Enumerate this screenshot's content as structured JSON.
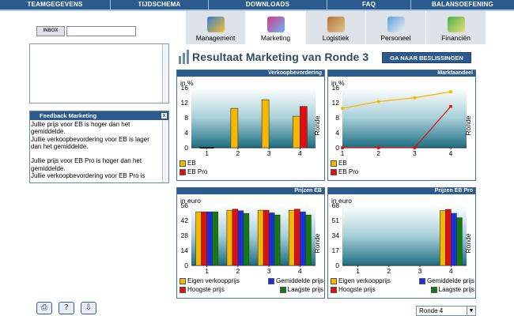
{
  "nav": [
    "TEAMGEGEVENS",
    "TIJDSCHEMA",
    "DOWNLOADS",
    "FAQ",
    "BALANSOEFENING"
  ],
  "inbox": {
    "label": "INBOX",
    "placeholder": ""
  },
  "feedback": {
    "title": "Feedback Marketing",
    "close": "x",
    "text": "Jullie prijs voor EB is hoger dan het gemiddelde.\nJullie verkoopbevordering voor EB is lager dan het gemiddelde.\n\nJullie prijs voor EB Pro is hoger dan het gemiddelde.\nJullie verkoopbevordering voor EB Pro is"
  },
  "tabs": [
    {
      "label": "Management",
      "icon": "management-icon"
    },
    {
      "label": "Marketing",
      "icon": "marketing-icon"
    },
    {
      "label": "Logistiek",
      "icon": "logistics-icon"
    },
    {
      "label": "Personeel",
      "icon": "personnel-icon"
    },
    {
      "label": "Financiën",
      "icon": "finance-icon"
    }
  ],
  "active_tab": "Marketing",
  "page_title": "Resultaat Marketing van Ronde 3",
  "go_button": "GA NAAR BESLISSINGEN",
  "round_select": {
    "value": "Ronde 4"
  },
  "colors": {
    "eb": "#f5b800",
    "ebpro": "#e01010",
    "avg": "#1a2ee0",
    "low": "#137a13",
    "nav": "#2a5b8c"
  },
  "chart_data": [
    {
      "type": "bar",
      "title": "Verkoopbevordering",
      "unit": "in %",
      "ylabel": "Ronde",
      "ylim": [
        0,
        16
      ],
      "yticks": [
        0,
        4,
        8,
        12,
        16
      ],
      "categories": [
        "1",
        "2",
        "3",
        "4"
      ],
      "series": [
        {
          "name": "EB",
          "values": [
            0,
            10.5,
            12.8,
            8.4
          ]
        },
        {
          "name": "EB Pro",
          "values": [
            0,
            0,
            0,
            11
          ]
        }
      ]
    },
    {
      "type": "line",
      "title": "Marktaandeel",
      "unit": "in %",
      "ylabel": "Ronde",
      "ylim": [
        0,
        16
      ],
      "yticks": [
        0,
        4,
        8,
        12,
        16
      ],
      "categories": [
        "1",
        "2",
        "3",
        "4"
      ],
      "series": [
        {
          "name": "EB",
          "values": [
            10.5,
            12.3,
            13.3,
            14.9
          ]
        },
        {
          "name": "EB Pro",
          "values": [
            0,
            0,
            0,
            11
          ]
        }
      ]
    },
    {
      "type": "bar",
      "title": "Prijzen EB",
      "unit": "in euro",
      "ylabel": "Ronde",
      "ylim": [
        0,
        56
      ],
      "yticks": [
        0,
        14,
        28,
        42,
        56
      ],
      "categories": [
        "1",
        "2",
        "3",
        "4"
      ],
      "series": [
        {
          "name": "Eigen verkoopprijs",
          "values": [
            50,
            51.5,
            51.5,
            51.5
          ]
        },
        {
          "name": "Hoogste prijs",
          "values": [
            50,
            52.5,
            51.5,
            52.5
          ]
        },
        {
          "name": "Gemiddelde prijs",
          "values": [
            50,
            51,
            49,
            50
          ]
        },
        {
          "name": "Laagste prijs",
          "values": [
            50,
            48.5,
            47,
            47
          ]
        }
      ]
    },
    {
      "type": "bar",
      "title": "Prijzen EB Pro",
      "unit": "in euro",
      "ylabel": "Ronde",
      "ylim": [
        0,
        68
      ],
      "yticks": [
        0,
        17,
        34,
        51,
        68
      ],
      "categories": [
        "1",
        "2",
        "3",
        "4"
      ],
      "series": [
        {
          "name": "Eigen verkoopprijs",
          "values": [
            0,
            0,
            0,
            62
          ]
        },
        {
          "name": "Hoogste prijs",
          "values": [
            0,
            0,
            0,
            63.5
          ]
        },
        {
          "name": "Gemiddelde prijs",
          "values": [
            0,
            0,
            0,
            59
          ]
        },
        {
          "name": "Laagste prijs",
          "values": [
            0,
            0,
            0,
            54
          ]
        }
      ]
    }
  ]
}
